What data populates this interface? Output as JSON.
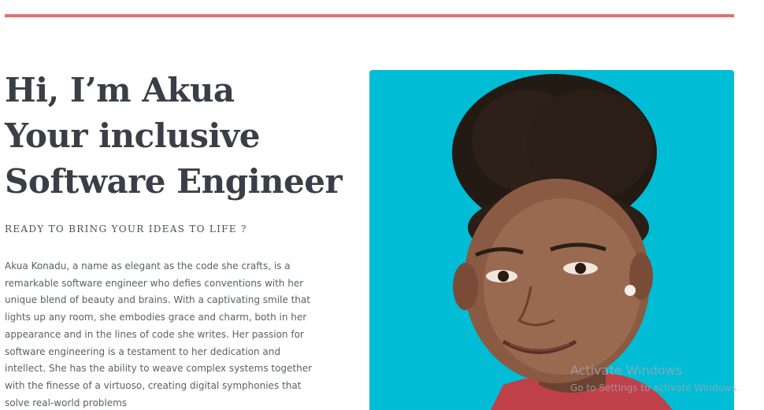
{
  "hero": {
    "heading_line1": "Hi, I’m Akua",
    "heading_line2": "Your inclusive",
    "heading_line3": "Software Engineer",
    "tagline": "READY TO BRING YOUR IDEAS TO LIFE ?",
    "bio": "Akua Konadu, a name as elegant as the code she crafts, is a remarkable software engineer who defies conventions with her unique blend of beauty and brains. With a captivating smile that lights up any room, she embodies grace and charm, both in her appearance and in the lines of code she writes. Her passion for software engineering is a testament to her dedication and intellect. She has the ability to weave complex systems together with the finesse of a virtuoso, creating digital symphonies that solve real-world problems"
  },
  "photo": {
    "background_color": "#00bcd4"
  },
  "colors": {
    "accent_rule": "#e07070",
    "heading": "#3a3f47"
  },
  "watermark": {
    "title": "Activate Windows",
    "subtitle": "Go to Settings to activate Windows."
  }
}
